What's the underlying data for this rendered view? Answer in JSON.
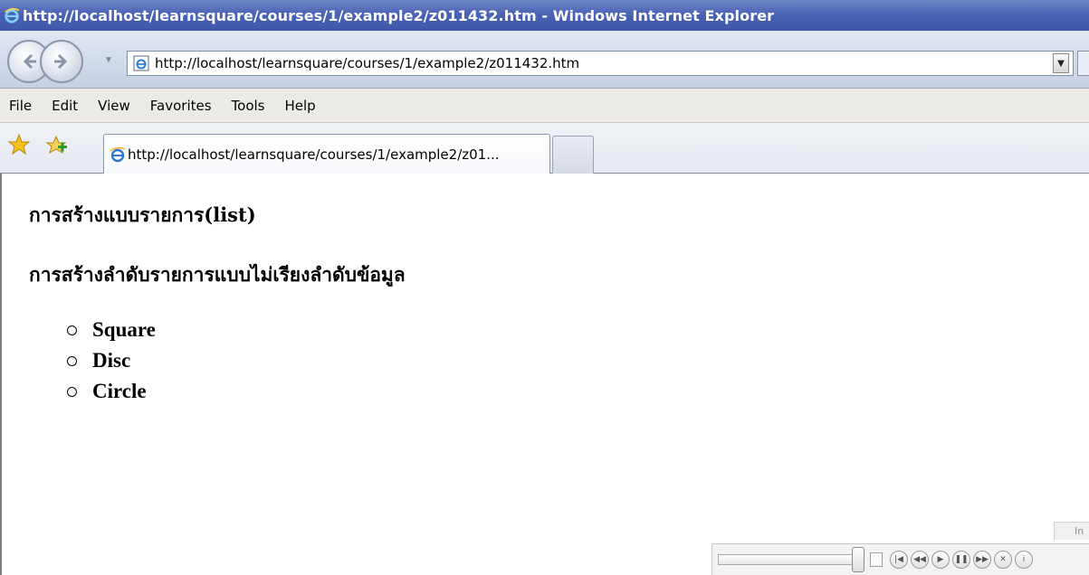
{
  "window": {
    "title": "http://localhost/learnsquare/courses/1/example2/z011432.htm - Windows Internet Explorer"
  },
  "address_bar": {
    "url": "http://localhost/learnsquare/courses/1/example2/z011432.htm"
  },
  "menu": {
    "items": [
      "File",
      "Edit",
      "View",
      "Favorites",
      "Tools",
      "Help"
    ]
  },
  "tabs": {
    "active_label": "http://localhost/learnsquare/courses/1/example2/z01..."
  },
  "page": {
    "title": "การสร้างแบบรายการ(list)",
    "subtitle": "การสร้างลำดับรายการแบบไม่เรียงลำดับข้อมูล",
    "list_items": [
      "Square",
      "Disc",
      "Circle"
    ]
  },
  "status": {
    "info_text": "In"
  },
  "colors": {
    "titlebar": "#4b63b4",
    "menubar": "#eceae4",
    "content_bg": "#ffffff"
  }
}
